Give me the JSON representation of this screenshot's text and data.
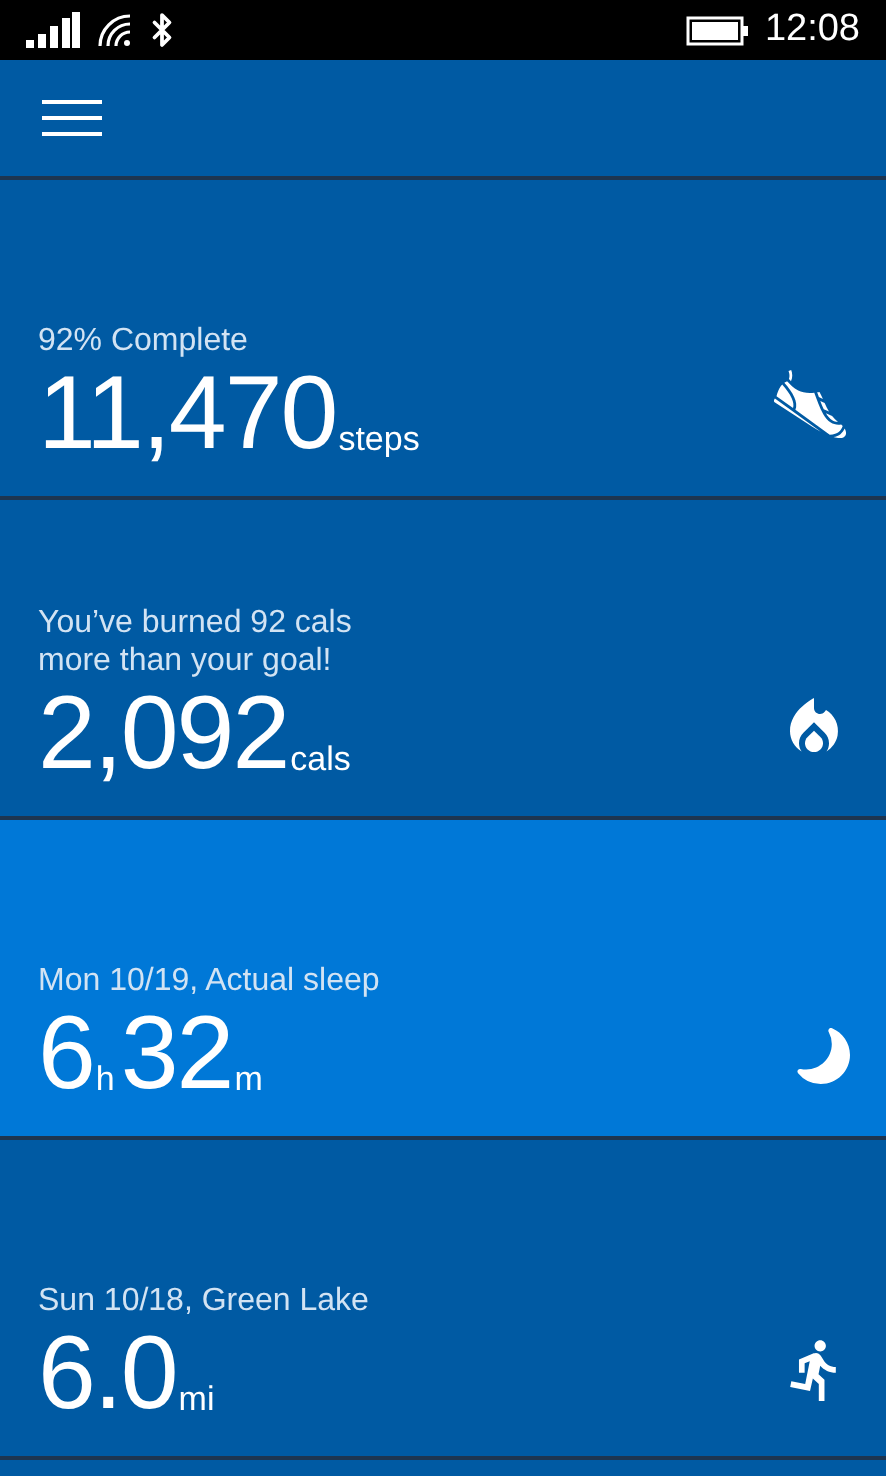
{
  "status_bar": {
    "time": "12:08"
  },
  "tiles": [
    {
      "kind": "steps",
      "selected": false,
      "caption": [
        "92% Complete"
      ],
      "value": [
        {
          "number": "11,470",
          "unit": "steps"
        }
      ]
    },
    {
      "kind": "calories",
      "selected": false,
      "caption": [
        "You’ve burned 92 cals",
        "more than your goal!"
      ],
      "value": [
        {
          "number": "2,092",
          "unit": "cals"
        }
      ]
    },
    {
      "kind": "sleep",
      "selected": true,
      "caption": [
        "Mon 10/19, Actual sleep"
      ],
      "value": [
        {
          "number": "6",
          "unit": "h"
        },
        {
          "number": "32",
          "unit": "m"
        }
      ]
    },
    {
      "kind": "run",
      "selected": false,
      "caption": [
        "Sun 10/18, Green Lake"
      ],
      "value": [
        {
          "number": "6.0",
          "unit": "mi"
        }
      ]
    }
  ]
}
